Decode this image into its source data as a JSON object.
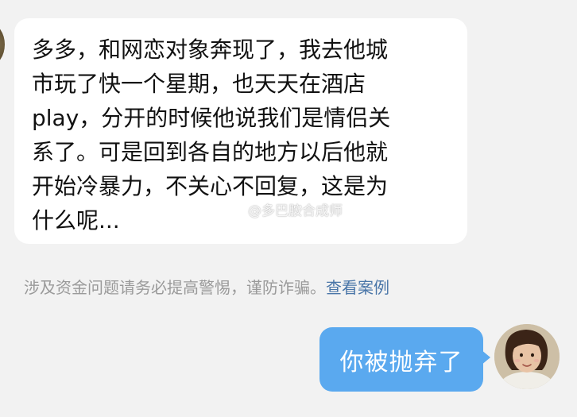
{
  "incoming_message": {
    "text": "多多，和网恋对象奔现了，我去他城\n市玩了快一个星期，也天天在酒店\nplay，分开的时候他说我们是情侣关\n系了。可是回到各自的地方以后他就\n开始冷暴力，不关心不回复，这是为\n什么呢..."
  },
  "watermark": {
    "text": "@多巴胺合成师",
    "icon": "weibo-icon"
  },
  "notice": {
    "text": "涉及资金问题请务必提高警惕，谨防诈骗。",
    "link_label": "查看案例"
  },
  "outgoing_message": {
    "text": "你被抛弃了"
  },
  "colors": {
    "background": "#f2f2f2",
    "incoming_bubble": "#ffffff",
    "outgoing_bubble": "#5aa9ef",
    "link": "#4a76a8",
    "notice_text": "#9a9a9a"
  }
}
